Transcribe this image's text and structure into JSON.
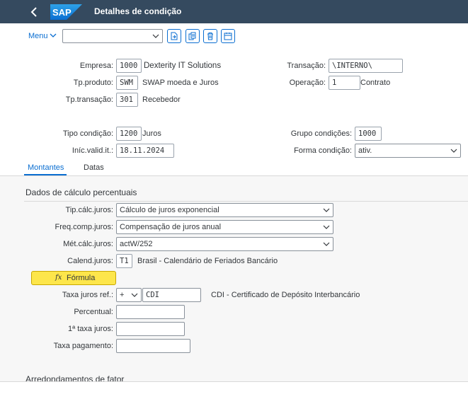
{
  "header": {
    "title": "Detalhes de condição",
    "logo_text": "SAP"
  },
  "toolbar": {
    "menu_label": "Menu",
    "action_select_value": ""
  },
  "fields": {
    "empresa": {
      "label": "Empresa:",
      "value": "1000",
      "desc": "Dexterity IT Solutions"
    },
    "transacao": {
      "label": "Transação:",
      "value": "\\INTERNO\\"
    },
    "tp_produto": {
      "label": "Tp.produto:",
      "value": "SWM",
      "desc": "SWAP moeda e Juros"
    },
    "operacao": {
      "label": "Operação:",
      "value": "1",
      "desc": "Contrato"
    },
    "tp_transacao": {
      "label": "Tp.transação:",
      "value": "301",
      "desc": "Recebedor"
    },
    "tipo_condicao": {
      "label": "Tipo condição:",
      "value": "1200",
      "desc": "Juros"
    },
    "grupo_condicoes": {
      "label": "Grupo condições:",
      "value": "1000"
    },
    "inic_valid": {
      "label": "Iníc.valid.it.:",
      "value": "18.11.2024"
    },
    "forma_condicao": {
      "label": "Forma condição:",
      "value": "ativ."
    }
  },
  "tabs": [
    {
      "label": "Montantes",
      "active": true
    },
    {
      "label": "Datas",
      "active": false
    }
  ],
  "section": {
    "title": "Dados de cálculo percentuais",
    "next_title": "Arredondamentos de fator",
    "tip_calc_juros": {
      "label": "Tip.cálc.juros:",
      "value": "Cálculo de juros exponencial"
    },
    "freq_comp_juros": {
      "label": "Freq.comp.juros:",
      "value": "Compensação de juros anual"
    },
    "met_calc_juros": {
      "label": "Mét.cálc.juros:",
      "value": "actW/252"
    },
    "calend_juros": {
      "label": "Calend.juros:",
      "value": "T1",
      "desc": "Brasil - Calendário de Feriados Bancário"
    },
    "formula_button": {
      "icon_text": "fx",
      "label": "Fórmula"
    },
    "taxa_juros_ref": {
      "label": "Taxa juros ref.:",
      "sign": "+",
      "value": "CDI",
      "desc": "CDI - Certificado de Depósito Interbancário"
    },
    "percentual": {
      "label": "Percentual:",
      "value": ""
    },
    "primeira_taxa": {
      "label": "1ª taxa juros:",
      "value": ""
    },
    "taxa_pagamento": {
      "label": "Taxa pagamento:",
      "value": ""
    }
  },
  "colors": {
    "shell": "#354a5f",
    "accent": "#0a6ed1",
    "formula_bg": "#fde64b"
  },
  "icons": [
    "back-icon",
    "sap-logo",
    "chevron-down-icon",
    "export-icon",
    "copy-icon",
    "delete-icon",
    "calendar-icon"
  ]
}
